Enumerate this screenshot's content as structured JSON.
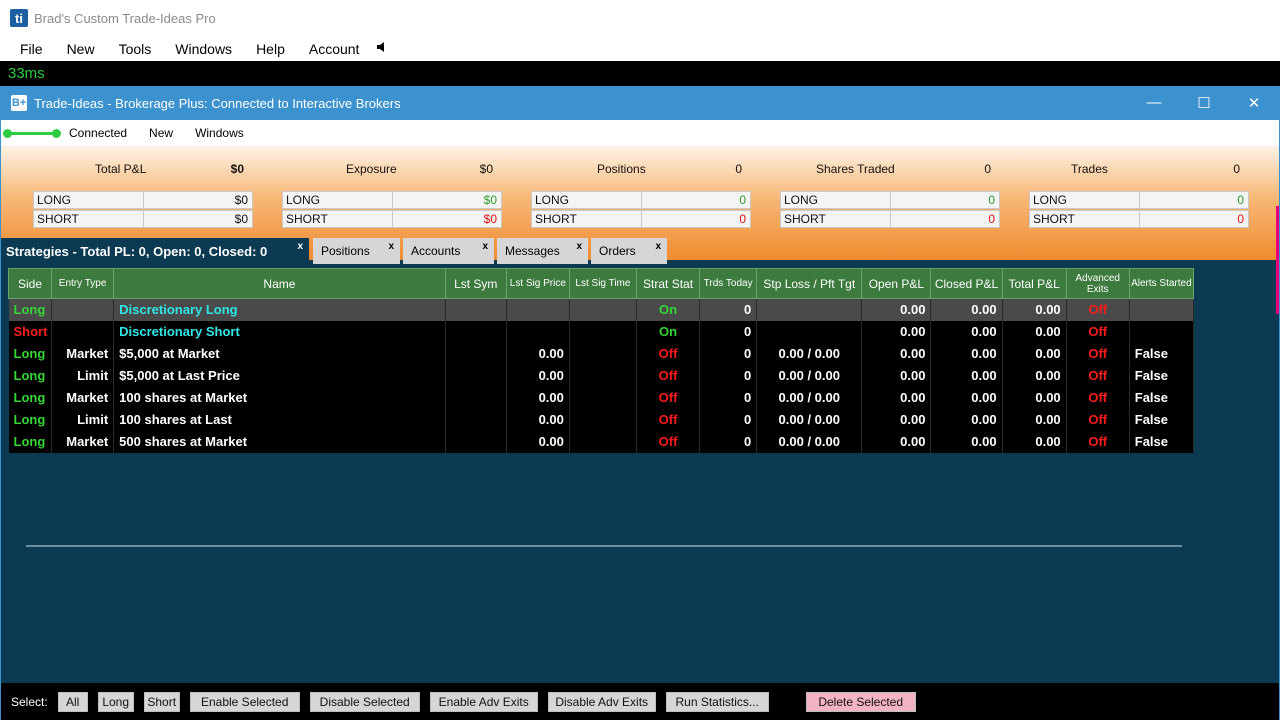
{
  "app": {
    "icon_text": "ti",
    "title": "Brad's Custom Trade-Ideas Pro",
    "menu": [
      "File",
      "New",
      "Tools",
      "Windows",
      "Help",
      "Account"
    ],
    "speaker_icon": "speaker-icon",
    "latency": "33ms"
  },
  "window": {
    "icon_text": "B+",
    "title": "Trade-Ideas - Brokerage Plus: Connected to Interactive Brokers",
    "controls": [
      "minimize-icon",
      "maximize-icon",
      "close-icon"
    ],
    "toolbar": {
      "connected": "Connected",
      "new": "New",
      "windows": "Windows"
    }
  },
  "summary": [
    {
      "head": "Total P&L",
      "total": "$0",
      "long": "$0",
      "short": "$0",
      "long_color": "#111111",
      "short_color": "#111111"
    },
    {
      "head": "Exposure",
      "total": "$0",
      "long": "$0",
      "short": "$0",
      "long_color": "#2a9d2a",
      "short_color": "#e01010"
    },
    {
      "head": "Positions",
      "total": "0",
      "long": "0",
      "short": "0",
      "long_color": "#2a9d2a",
      "short_color": "#e01010"
    },
    {
      "head": "Shares Traded",
      "total": "0",
      "long": "0",
      "short": "0",
      "long_color": "#2a9d2a",
      "short_color": "#e01010"
    },
    {
      "head": "Trades",
      "total": "0",
      "long": "0",
      "short": "0",
      "long_color": "#2a9d2a",
      "short_color": "#e01010"
    }
  ],
  "summary_row_labels": {
    "long": "LONG",
    "short": "SHORT"
  },
  "tabs": [
    {
      "label": "Strategies - Total PL: 0, Open: 0, Closed: 0",
      "active": true
    },
    {
      "label": "Positions",
      "active": false
    },
    {
      "label": "Accounts",
      "active": false
    },
    {
      "label": "Messages",
      "active": false
    },
    {
      "label": "Orders",
      "active": false
    }
  ],
  "tab_close": "x",
  "columns": [
    "Side",
    "Entry Type",
    "Name",
    "Lst Sym",
    "Lst Sig Price",
    "Lst Sig Time",
    "Strat Stat",
    "Trds Today",
    "Stp Loss / Pft Tgt",
    "Open P&L",
    "Closed P&L",
    "Total P&L",
    "Advanced Exits",
    "Alerts Started"
  ],
  "rows": [
    {
      "side": "Long",
      "entry": "",
      "name": "Discretionary Long",
      "sym": "",
      "price": "",
      "time": "",
      "stat": "On",
      "trds": "0",
      "stp": "",
      "open": "0.00",
      "closed": "0.00",
      "total": "0.00",
      "adv": "Off",
      "alerts": "",
      "selected": true,
      "name_color": "cyan"
    },
    {
      "side": "Short",
      "entry": "",
      "name": "Discretionary Short",
      "sym": "",
      "price": "",
      "time": "",
      "stat": "On",
      "trds": "0",
      "stp": "",
      "open": "0.00",
      "closed": "0.00",
      "total": "0.00",
      "adv": "Off",
      "alerts": "",
      "selected": false,
      "name_color": "cyan"
    },
    {
      "side": "Long",
      "entry": "Market",
      "name": "$5,000 at Market",
      "sym": "",
      "price": "0.00",
      "time": "",
      "stat": "Off",
      "trds": "0",
      "stp": "0.00 / 0.00",
      "open": "0.00",
      "closed": "0.00",
      "total": "0.00",
      "adv": "Off",
      "alerts": "False",
      "selected": false,
      "name_color": "white"
    },
    {
      "side": "Long",
      "entry": "Limit",
      "name": "$5,000 at Last Price",
      "sym": "",
      "price": "0.00",
      "time": "",
      "stat": "Off",
      "trds": "0",
      "stp": "0.00 / 0.00",
      "open": "0.00",
      "closed": "0.00",
      "total": "0.00",
      "adv": "Off",
      "alerts": "False",
      "selected": false,
      "name_color": "white"
    },
    {
      "side": "Long",
      "entry": "Market",
      "name": "100 shares at Market",
      "sym": "",
      "price": "0.00",
      "time": "",
      "stat": "Off",
      "trds": "0",
      "stp": "0.00 / 0.00",
      "open": "0.00",
      "closed": "0.00",
      "total": "0.00",
      "adv": "Off",
      "alerts": "False",
      "selected": false,
      "name_color": "white"
    },
    {
      "side": "Long",
      "entry": "Limit",
      "name": "100 shares at Last",
      "sym": "",
      "price": "0.00",
      "time": "",
      "stat": "Off",
      "trds": "0",
      "stp": "0.00 / 0.00",
      "open": "0.00",
      "closed": "0.00",
      "total": "0.00",
      "adv": "Off",
      "alerts": "False",
      "selected": false,
      "name_color": "white"
    },
    {
      "side": "Long",
      "entry": "Market",
      "name": "500 shares at Market",
      "sym": "",
      "price": "0.00",
      "time": "",
      "stat": "Off",
      "trds": "0",
      "stp": "0.00 / 0.00",
      "open": "0.00",
      "closed": "0.00",
      "total": "0.00",
      "adv": "Off",
      "alerts": "False",
      "selected": false,
      "name_color": "white"
    }
  ],
  "bottom": {
    "select_label": "Select:",
    "buttons": [
      "All",
      "Long",
      "Short",
      "Enable Selected",
      "Disable Selected",
      "Enable Adv Exits",
      "Disable Adv Exits",
      "Run Statistics...",
      "Delete Selected"
    ]
  }
}
